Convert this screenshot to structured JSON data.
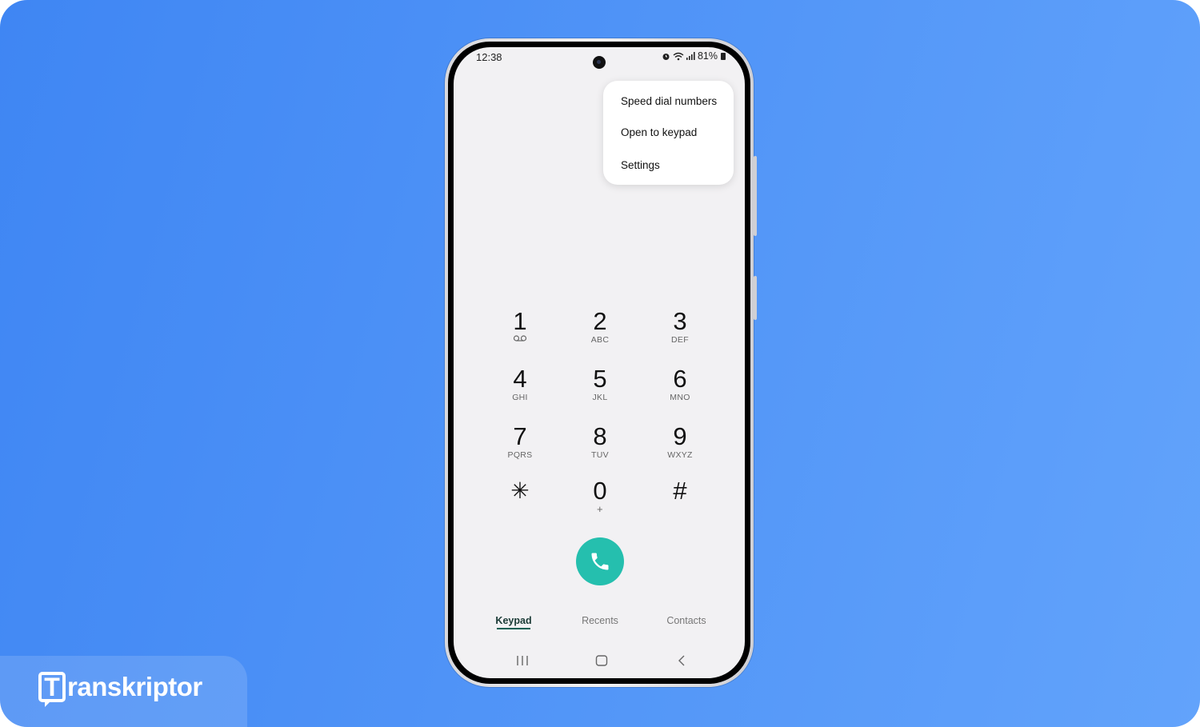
{
  "status_bar": {
    "time": "12:38",
    "battery": "81%"
  },
  "menu": {
    "items": [
      "Speed dial numbers",
      "Open to keypad",
      "Settings"
    ]
  },
  "keypad": {
    "keys": [
      {
        "digit": "1",
        "letters": ""
      },
      {
        "digit": "2",
        "letters": "ABC"
      },
      {
        "digit": "3",
        "letters": "DEF"
      },
      {
        "digit": "4",
        "letters": "GHI"
      },
      {
        "digit": "5",
        "letters": "JKL"
      },
      {
        "digit": "6",
        "letters": "MNO"
      },
      {
        "digit": "7",
        "letters": "PQRS"
      },
      {
        "digit": "8",
        "letters": "TUV"
      },
      {
        "digit": "9",
        "letters": "WXYZ"
      },
      {
        "digit": "✳",
        "letters": ""
      },
      {
        "digit": "0",
        "letters": "+"
      },
      {
        "digit": "#",
        "letters": ""
      }
    ]
  },
  "tabs": [
    {
      "label": "Keypad",
      "active": true
    },
    {
      "label": "Recents",
      "active": false
    },
    {
      "label": "Contacts",
      "active": false
    }
  ],
  "brand": {
    "mark": "T",
    "text": "ranskriptor"
  },
  "colors": {
    "background": "#4f93f7",
    "call_button": "#25bfae",
    "active_tab": "#0f5f53"
  },
  "icons": [
    "voicemail-icon",
    "phone-icon",
    "alarm-icon",
    "wifi-icon",
    "signal-icon",
    "battery-icon",
    "recents-nav-icon",
    "home-nav-icon",
    "back-nav-icon"
  ]
}
